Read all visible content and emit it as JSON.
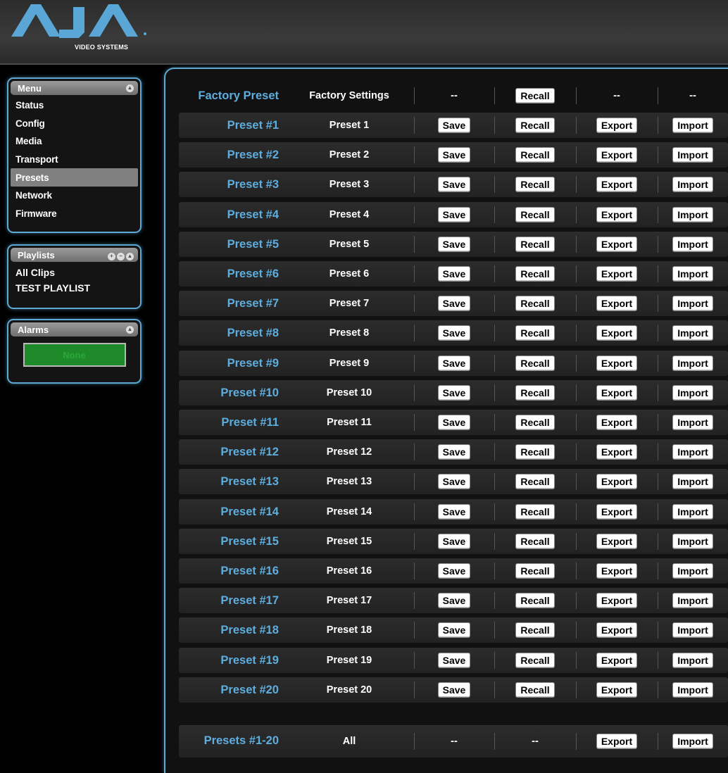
{
  "brand": {
    "logo_text": "AJA",
    "sub_text": "VIDEO SYSTEMS"
  },
  "menu": {
    "title": "Menu",
    "items": [
      "Status",
      "Config",
      "Media",
      "Transport",
      "Presets",
      "Network",
      "Firmware"
    ],
    "active": "Presets"
  },
  "playlists": {
    "title": "Playlists",
    "items": [
      "All Clips",
      "TEST PLAYLIST"
    ]
  },
  "alarms": {
    "title": "Alarms",
    "status": "None"
  },
  "presets": {
    "factory": {
      "label": "Factory Preset",
      "name": "Factory Settings",
      "save": "--",
      "recall": "Recall",
      "export": "--",
      "import": "--"
    },
    "rows": [
      {
        "label": "Preset #1",
        "name": "Preset 1"
      },
      {
        "label": "Preset #2",
        "name": "Preset 2"
      },
      {
        "label": "Preset #3",
        "name": "Preset 3"
      },
      {
        "label": "Preset #4",
        "name": "Preset 4"
      },
      {
        "label": "Preset #5",
        "name": "Preset 5"
      },
      {
        "label": "Preset #6",
        "name": "Preset 6"
      },
      {
        "label": "Preset #7",
        "name": "Preset 7"
      },
      {
        "label": "Preset #8",
        "name": "Preset 8"
      },
      {
        "label": "Preset #9",
        "name": "Preset 9"
      },
      {
        "label": "Preset #10",
        "name": "Preset 10"
      },
      {
        "label": "Preset #11",
        "name": "Preset 11"
      },
      {
        "label": "Preset #12",
        "name": "Preset 12"
      },
      {
        "label": "Preset #13",
        "name": "Preset 13"
      },
      {
        "label": "Preset #14",
        "name": "Preset 14"
      },
      {
        "label": "Preset #15",
        "name": "Preset 15"
      },
      {
        "label": "Preset #16",
        "name": "Preset 16"
      },
      {
        "label": "Preset #17",
        "name": "Preset 17"
      },
      {
        "label": "Preset #18",
        "name": "Preset 18"
      },
      {
        "label": "Preset #19",
        "name": "Preset 19"
      },
      {
        "label": "Preset #20",
        "name": "Preset 20"
      }
    ],
    "button_labels": {
      "save": "Save",
      "recall": "Recall",
      "export": "Export",
      "import": "Import"
    },
    "all": {
      "label": "Presets #1-20",
      "name": "All",
      "save": "--",
      "recall": "--",
      "export": "Export",
      "import": "Import"
    }
  },
  "colors": {
    "accent": "#5da9d4",
    "label_blue": "#5daedf",
    "alarm_green": "#1f8a2a"
  },
  "icons": {
    "collapse": "collapse-icon",
    "add": "add-icon",
    "remove": "remove-icon"
  }
}
